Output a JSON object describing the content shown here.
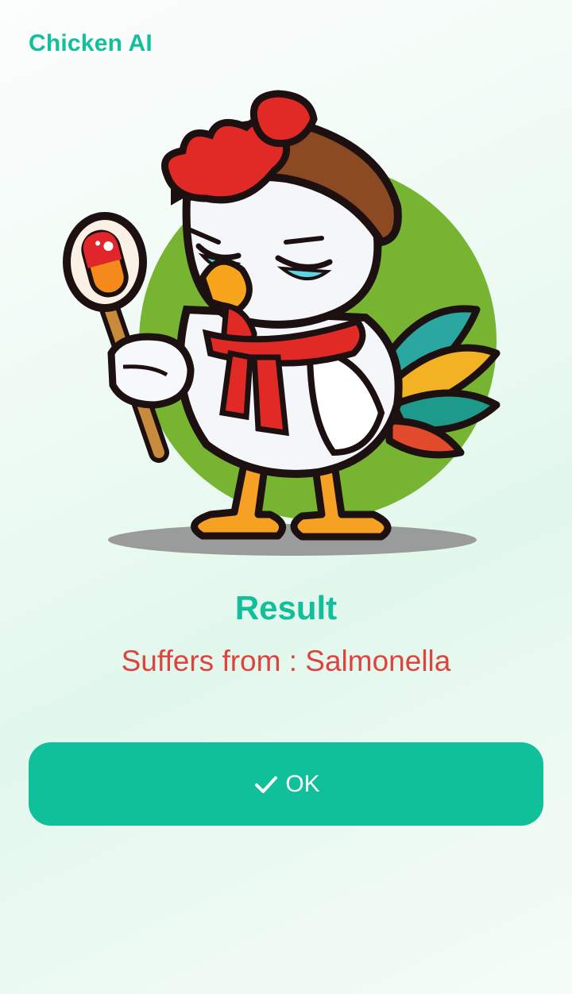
{
  "app": {
    "title": "Chicken AI"
  },
  "illustration": {
    "subject": "sick-chicken-mascot-with-pill-and-scarf"
  },
  "result": {
    "title": "Result",
    "prefix": "Suffers from : ",
    "disease": "Salmonella"
  },
  "actions": {
    "ok_label": "OK",
    "ok_icon": "check-icon"
  },
  "colors": {
    "accent": "#12bf9a",
    "button": "#10c09a",
    "diagnosis": "#e0433d"
  }
}
